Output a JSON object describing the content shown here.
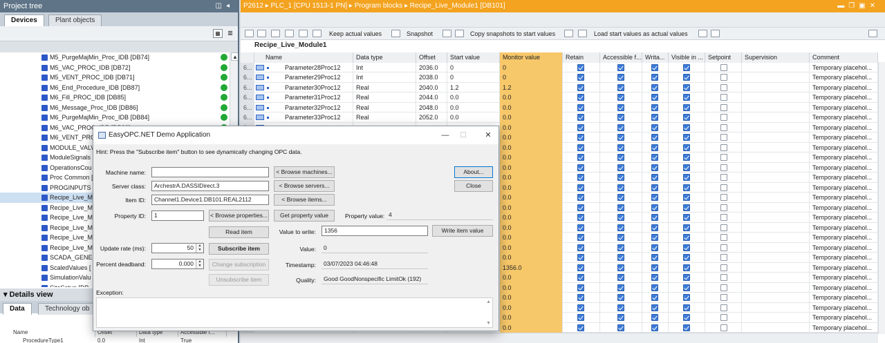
{
  "project_tree": {
    "title": "Project tree",
    "tabs": [
      "Devices",
      "Plant objects"
    ],
    "items": [
      "M5_PurgeMajMin_Proc_IDB [DB74]",
      "M5_VAC_PROC_IDB [DB72]",
      "M5_VENT_PROC_IDB [DB71]",
      "M6_End_Procedure_IDB [DB87]",
      "M6_Fill_PROC_IDB [DB85]",
      "M6_Message_Proc_IDB [DB86]",
      "M6_PurgeMajMin_Proc_IDB [DB84]",
      "M6_VAC_PROC_IDB [DB82]",
      "M6_VENT_PROC",
      "MODULE_VALV",
      "ModuleSignals",
      "OperationsCou",
      "Proc Common [",
      "PROGINPUTS [D",
      "Recipe_Live_M",
      "Recipe_Live_M",
      "Recipe_Live_M",
      "Recipe_Live_M",
      "Recipe_Live_M",
      "Recipe_Live_M",
      "SCADA_GENER",
      "ScaledValues [",
      "SimulationValu",
      "SiteSetup [DB"
    ],
    "selected_index": 14
  },
  "details_view": {
    "title": "Details view",
    "tabs": [
      "Data",
      "Technology ob"
    ],
    "columns": [
      "Name",
      "Offset",
      "Data type",
      "Accessible f..."
    ],
    "row": [
      "ProcedureType1",
      "0.0",
      "Int",
      "True"
    ]
  },
  "editor": {
    "breadcrumb": [
      "P2612",
      "PLC_1 [CPU 1513-1 PN]",
      "Program blocks",
      "Recipe_Live_Module1 [DB101]"
    ],
    "toolbar": {
      "keep_actual": "Keep actual values",
      "snapshot": "Snapshot",
      "copy_snapshots": "Copy snapshots to start values",
      "load_start": "Load start values as actual values"
    },
    "db_name": "Recipe_Live_Module1",
    "columns": [
      "Name",
      "Data type",
      "Offset",
      "Start value",
      "Monitor value",
      "Retain",
      "Accessible f...",
      "Writa...",
      "Visible in ...",
      "Setpoint",
      "Supervision",
      "Comment"
    ],
    "rows": [
      {
        "num": "6...",
        "name": "Parameter28Proc12",
        "type": "Int",
        "offset": "2036.0",
        "start": "0",
        "monitor": "0",
        "comment": "Temporary placehol..."
      },
      {
        "num": "6...",
        "name": "Parameter29Proc12",
        "type": "Int",
        "offset": "2038.0",
        "start": "0",
        "monitor": "0",
        "comment": "Temporary placehol..."
      },
      {
        "num": "6...",
        "name": "Parameter30Proc12",
        "type": "Real",
        "offset": "2040.0",
        "start": "1.2",
        "monitor": "1.2",
        "comment": "Temporary placehol..."
      },
      {
        "num": "6...",
        "name": "Parameter31Proc12",
        "type": "Real",
        "offset": "2044.0",
        "start": "0.0",
        "monitor": "0.0",
        "comment": "Temporary placehol..."
      },
      {
        "num": "6...",
        "name": "Parameter32Proc12",
        "type": "Real",
        "offset": "2048.0",
        "start": "0.0",
        "monitor": "0.0",
        "comment": "Temporary placehol..."
      },
      {
        "num": "6...",
        "name": "Parameter33Proc12",
        "type": "Real",
        "offset": "2052.0",
        "start": "0.0",
        "monitor": "0.0",
        "comment": "Temporary placehol..."
      },
      {
        "num": "6...",
        "name": "",
        "type": "",
        "offset": "",
        "start": "",
        "monitor": "0.0",
        "comment": "Temporary placehol..."
      },
      {
        "num": "6...",
        "name": "",
        "type": "",
        "offset": "",
        "start": "",
        "monitor": "0.0",
        "comment": "Temporary placehol..."
      },
      {
        "num": "6...",
        "name": "",
        "type": "",
        "offset": "",
        "start": "",
        "monitor": "0.0",
        "comment": "Temporary placehol..."
      },
      {
        "num": "6...",
        "name": "",
        "type": "",
        "offset": "",
        "start": "",
        "monitor": "0.0",
        "comment": "Temporary placehol..."
      },
      {
        "num": "6...",
        "name": "",
        "type": "",
        "offset": "",
        "start": "",
        "monitor": "0.0",
        "comment": "Temporary placehol..."
      },
      {
        "num": "6...",
        "name": "",
        "type": "",
        "offset": "",
        "start": "",
        "monitor": "0.0",
        "comment": "Temporary placehol..."
      },
      {
        "num": "6...",
        "name": "",
        "type": "",
        "offset": "",
        "start": "",
        "monitor": "0.0",
        "comment": "Temporary placehol..."
      },
      {
        "num": "6...",
        "name": "",
        "type": "",
        "offset": "",
        "start": "",
        "monitor": "0.0",
        "comment": "Temporary placehol..."
      },
      {
        "num": "6...",
        "name": "",
        "type": "",
        "offset": "",
        "start": "",
        "monitor": "0.0",
        "comment": "Temporary placehol..."
      },
      {
        "num": "6...",
        "name": "",
        "type": "",
        "offset": "",
        "start": "",
        "monitor": "0.0",
        "comment": "Temporary placehol..."
      },
      {
        "num": "6...",
        "name": "",
        "type": "",
        "offset": "",
        "start": "",
        "monitor": "0.0",
        "comment": "Temporary placehol..."
      },
      {
        "num": "6...",
        "name": "",
        "type": "",
        "offset": "",
        "start": "",
        "monitor": "0.0",
        "comment": "Temporary placehol..."
      },
      {
        "num": "6...",
        "name": "",
        "type": "",
        "offset": "",
        "start": "",
        "monitor": "0.0",
        "comment": "Temporary placehol..."
      },
      {
        "num": "6...",
        "name": "",
        "type": "",
        "offset": "",
        "start": "",
        "monitor": "0.0",
        "comment": "Temporary placehol..."
      },
      {
        "num": "6...",
        "name": "",
        "type": "",
        "offset": "",
        "start": "",
        "monitor": "1356.0",
        "comment": "Temporary placehol..."
      },
      {
        "num": "6...",
        "name": "",
        "type": "",
        "offset": "",
        "start": "",
        "monitor": "0.0",
        "comment": "Temporary placehol..."
      },
      {
        "num": "6...",
        "name": "",
        "type": "",
        "offset": "",
        "start": "",
        "monitor": "0.0",
        "comment": "Temporary placehol..."
      },
      {
        "num": "6...",
        "name": "",
        "type": "",
        "offset": "",
        "start": "",
        "monitor": "0.0",
        "comment": "Temporary placehol..."
      },
      {
        "num": "6...",
        "name": "",
        "type": "",
        "offset": "",
        "start": "",
        "monitor": "0.0",
        "comment": "Temporary placehol..."
      },
      {
        "num": "6...",
        "name": "",
        "type": "",
        "offset": "",
        "start": "",
        "monitor": "0.0",
        "comment": "Temporary placehol..."
      },
      {
        "num": "6...",
        "name": "",
        "type": "",
        "offset": "",
        "start": "",
        "monitor": "0.0",
        "comment": "Temporary placehol..."
      }
    ]
  },
  "dialog": {
    "title": "EasyOPC.NET Demo Application",
    "hint": "Hint: Press the \"Subscribe item\" button to see dynamically changing OPC data.",
    "machine_name_label": "Machine name:",
    "machine_name_value": "",
    "browse_machines": "< Browse machines...",
    "server_class_label": "Server class:",
    "server_class_value": "ArchestrA.DASSIDirect.3",
    "browse_servers": "< Browse servers...",
    "item_id_label": "Item ID:",
    "item_id_value": "Channel1.Device1.DB101.REAL2112",
    "browse_items": "< Browse items...",
    "property_id_label": "Property ID:",
    "property_id_value": "1",
    "browse_properties": "< Browse properties...",
    "get_property_value": "Get property value",
    "property_value_label": "Property value:",
    "property_value": "4",
    "about": "About...",
    "close": "Close",
    "read_item": "Read item",
    "value_to_write_label": "Value to write:",
    "value_to_write": "1356",
    "write_item_value": "Write item value",
    "update_rate_label": "Update rate (ms):",
    "update_rate": "50",
    "subscribe_item": "Subscribe item",
    "value_label": "Value:",
    "value": "0",
    "percent_deadband_label": "Percent deadband:",
    "percent_deadband": "0.000",
    "change_subscription": "Change subscription",
    "timestamp_label": "Timestamp:",
    "timestamp": "03/07/2023 04:46:48",
    "unsubscribe_item": "Unsubscribe item",
    "quality_label": "Quality:",
    "quality": "Good GoodNonspecific LimitOk (192)",
    "exception_label": "Exception:"
  }
}
